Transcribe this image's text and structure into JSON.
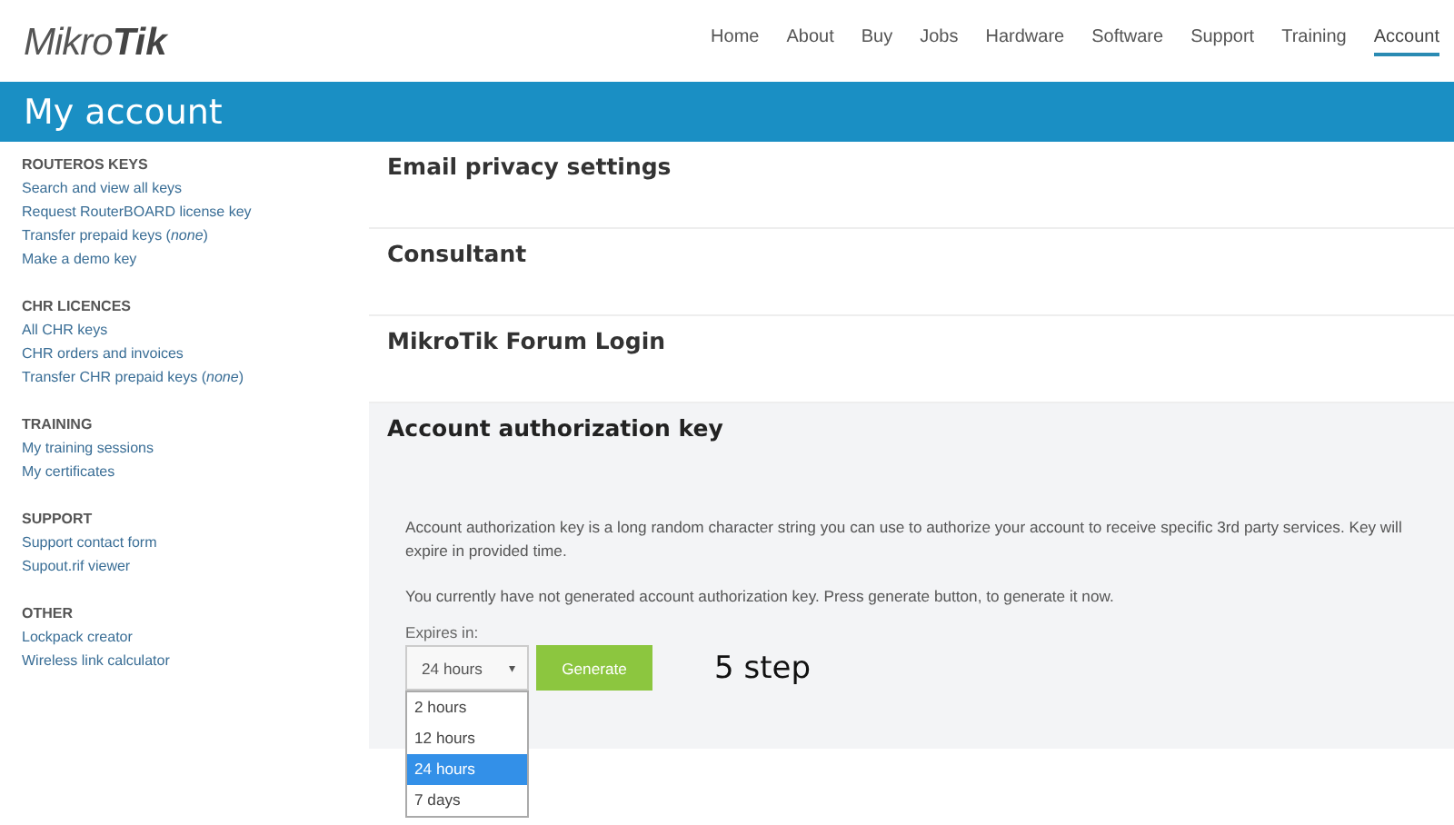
{
  "logo": {
    "text_light": "Mikro",
    "text_bold": "Tik"
  },
  "nav": [
    {
      "label": "Home",
      "selected": false
    },
    {
      "label": "About",
      "selected": false
    },
    {
      "label": "Buy",
      "selected": false
    },
    {
      "label": "Jobs",
      "selected": false
    },
    {
      "label": "Hardware",
      "selected": false
    },
    {
      "label": "Software",
      "selected": false
    },
    {
      "label": "Support",
      "selected": false
    },
    {
      "label": "Training",
      "selected": false
    },
    {
      "label": "Account",
      "selected": true
    }
  ],
  "page_title": "My account",
  "sidebar": [
    {
      "heading": "ROUTEROS KEYS",
      "links": [
        "Search and view all keys",
        "Request RouterBOARD license key",
        "Transfer prepaid keys (*none*)",
        "Make a demo key"
      ]
    },
    {
      "heading": "CHR LICENCES",
      "links": [
        "All CHR keys",
        "CHR orders and invoices",
        "Transfer CHR prepaid keys (*none*)"
      ]
    },
    {
      "heading": "TRAINING",
      "links": [
        "My training sessions",
        "My certificates"
      ]
    },
    {
      "heading": "SUPPORT",
      "links": [
        "Support contact form",
        "Supout.rif viewer"
      ]
    },
    {
      "heading": "OTHER",
      "links": [
        "Lockpack creator",
        "Wireless link calculator"
      ]
    }
  ],
  "sections": [
    {
      "title": "Email privacy settings",
      "expanded": false
    },
    {
      "title": "Consultant",
      "expanded": false
    },
    {
      "title": "MikroTik Forum Login",
      "expanded": false
    },
    {
      "title": "Account authorization key",
      "expanded": true
    }
  ],
  "auth_panel": {
    "description": "Account authorization key is a long random character string you can use to authorize your account to receive specific 3rd party services. Key will expire in provided time.",
    "status": "You currently have not generated account authorization key. Press generate button, to generate it now.",
    "expires_label": "Expires in:",
    "select_value": "24 hours",
    "caret": "▾",
    "options": [
      {
        "label": "2 hours",
        "selected": false
      },
      {
        "label": "12 hours",
        "selected": false
      },
      {
        "label": "24 hours",
        "selected": true
      },
      {
        "label": "7 days",
        "selected": false
      }
    ],
    "generate_button": "Generate",
    "annotation": "5 step"
  }
}
